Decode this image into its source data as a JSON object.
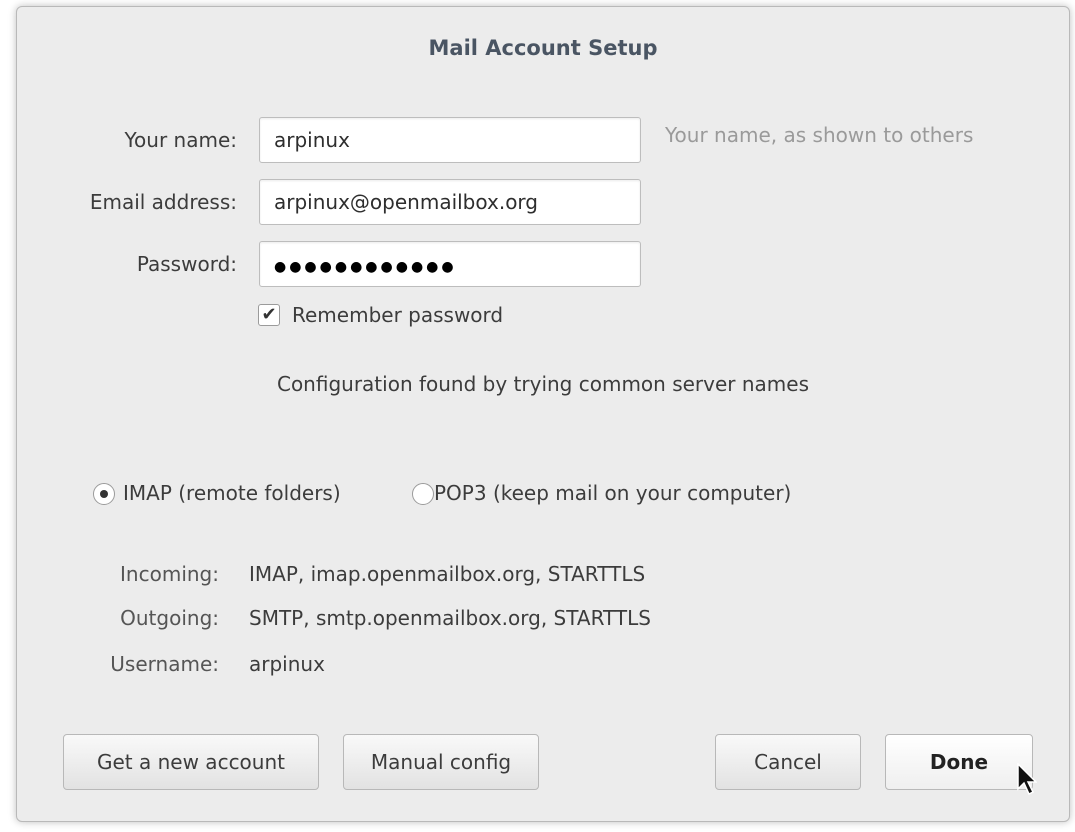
{
  "dialog": {
    "title": "Mail Account Setup"
  },
  "form": {
    "name_label": "Your name:",
    "name_value": "arpinux",
    "name_hint": "Your name, as shown to others",
    "email_label": "Email address:",
    "email_value": "arpinux@openmailbox.org",
    "password_label": "Password:",
    "password_mask": "●●●●●●●●●●●●",
    "remember_checked": true,
    "remember_label": "Remember password"
  },
  "status_message": "Configuration found by trying common server names",
  "protocol": {
    "selected": "IMAP",
    "imap_label": "IMAP (remote folders)",
    "pop3_label": "POP3 (keep mail on your computer)"
  },
  "server_info": {
    "incoming_label": "Incoming:",
    "incoming_value": "IMAP, imap.openmailbox.org, STARTTLS",
    "outgoing_label": "Outgoing:",
    "outgoing_value": "SMTP, smtp.openmailbox.org, STARTTLS",
    "username_label": "Username:",
    "username_value": "arpinux"
  },
  "buttons": {
    "new_account": "Get a new account",
    "manual_config": "Manual config",
    "cancel": "Cancel",
    "done": "Done"
  },
  "icons": {
    "checkbox": "checkmark-icon",
    "cursor": "mouse-pointer-icon"
  }
}
